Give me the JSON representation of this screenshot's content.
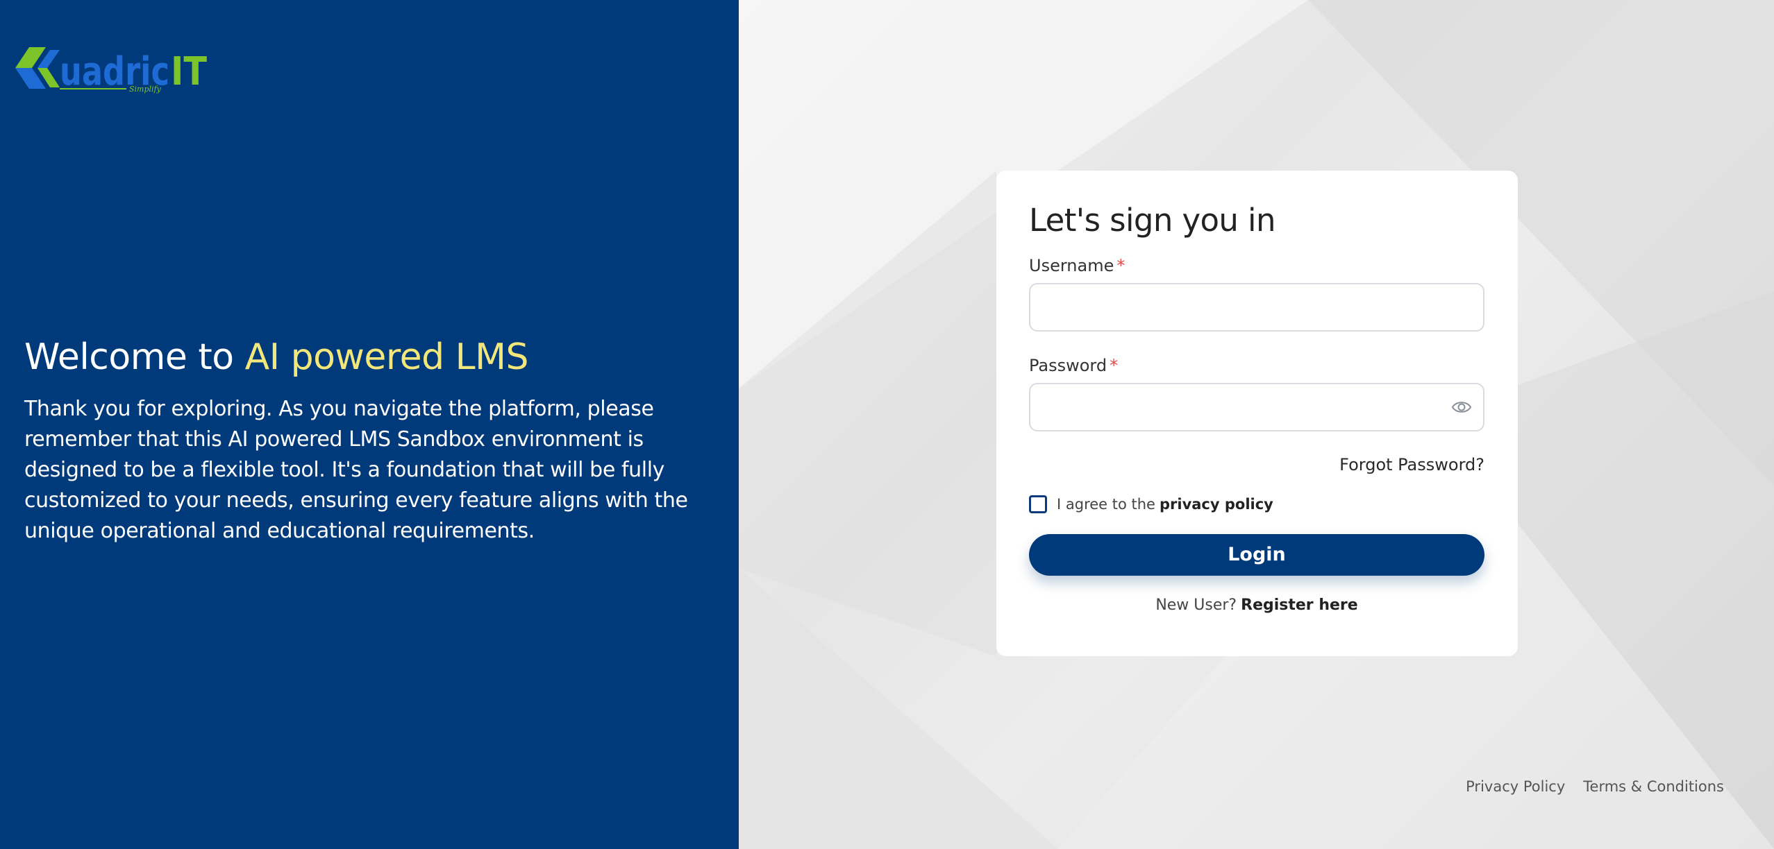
{
  "brand": {
    "logo_text": "QuadricIT",
    "logo_tagline": "Simplify",
    "colors": {
      "primary": "#003a7a",
      "accent": "#f4e77a",
      "logo_green": "#7dc42b",
      "logo_blue": "#1f6bd6"
    }
  },
  "left": {
    "welcome_prefix": "Welcome to ",
    "welcome_highlight": "AI powered LMS",
    "description": "Thank you for exploring. As you navigate the platform, please remember that this AI powered LMS Sandbox environment is designed to be a flexible tool. It's a foundation that will be fully customized to your needs, ensuring every feature aligns with the unique operational and educational requirements."
  },
  "login": {
    "title": "Let's sign you in",
    "username_label": "Username",
    "username_value": "",
    "password_label": "Password",
    "password_value": "",
    "required_mark": "*",
    "password_toggle_icon": "eye-icon",
    "forgot_password": "Forgot Password?",
    "agree_prefix": "I agree to the",
    "agree_link": "privacy policy",
    "agree_checked": false,
    "login_button": "Login",
    "new_user_prefix": "New User?",
    "register_link": "Register here"
  },
  "footer": {
    "privacy_policy": "Privacy Policy",
    "terms": "Terms & Conditions"
  }
}
